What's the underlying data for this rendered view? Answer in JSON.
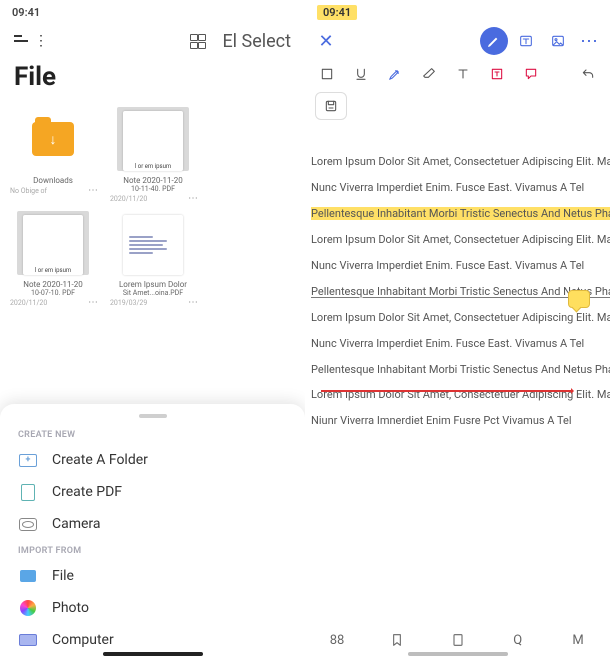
{
  "status": {
    "time": "09:41"
  },
  "left": {
    "header_right": "El Select",
    "title": "File",
    "files": [
      {
        "name": "Downloads",
        "sub": "",
        "date": "No Obige of"
      },
      {
        "name": "Note 2020-11-20",
        "sub": "10-11-40. PDF",
        "date": "2020/11/20"
      },
      {
        "name": "Note 2020-11-20",
        "sub": "10-07-10. PDF",
        "date": "2020/11/20"
      },
      {
        "name": "Lorem Ipsum Dolor",
        "sub": "Sit Amet...oina.PDF",
        "date": "2019/03/29"
      }
    ],
    "sheet": {
      "create_label": "CREATE NEW",
      "import_label": "IMPORT FROM",
      "items_create": [
        "Create A Folder",
        "Create PDF",
        "Camera"
      ],
      "items_import": [
        "File",
        "Photo",
        "Computer"
      ]
    }
  },
  "right": {
    "paras": [
      "Lorem Ipsum Dolor Sit Amet, Consectetuer Adipiscing Elit. Magna Sed Pulvinar Ultricies, Purus Lectus Malesuada",
      "Nunc Viverra Imperdiet Enim. Fusce East. Vivamus A Tel",
      "Pellentesque Inhabitant Morbi Tristic Senectus And Netus Pharetra Nonummy Asks. Mauris And Orci.",
      "Lorem Ipsum Dolor Sit Amet, Consectetuer Adipiscing Elit. Magna Sed Pulvinar Ultricies, Purus Lectus Malesuada",
      "Nunc Viverra Imperdiet Enim. Fusce East. Vivamus A Tel",
      "Pellentesque Inhabitant Morbi Tristic Senectus And Netus Pharetra Nonummy Asks. Mauris And Orci.",
      "Lorem Ipsum Dolor Sit Amet, Consectetuer Adipiscing Elit. Magna Sed Pulvinar Ultricies, Purus Lectus Malesuada",
      "Nunc Viverra Imperdiet Enim. Fusce East. Vivamus A Tel",
      "Pellentesque Inhabitant Morbi Tristic Senectus And Netus Pharetra Nonummy Asks. Mauris And Orci.",
      "Lorem Ipsum Dolor Sit Amet, Consectetuer Adipiscing Elit. Magna Sed Pulvinar Ultricies, Purus Lectus Malesuada",
      "Niunr Viverra Imnerdiet Enim Fusre Pct Vivamus A Tel"
    ],
    "page_count": "88",
    "bb_q": "Q",
    "bb_m": "M"
  }
}
